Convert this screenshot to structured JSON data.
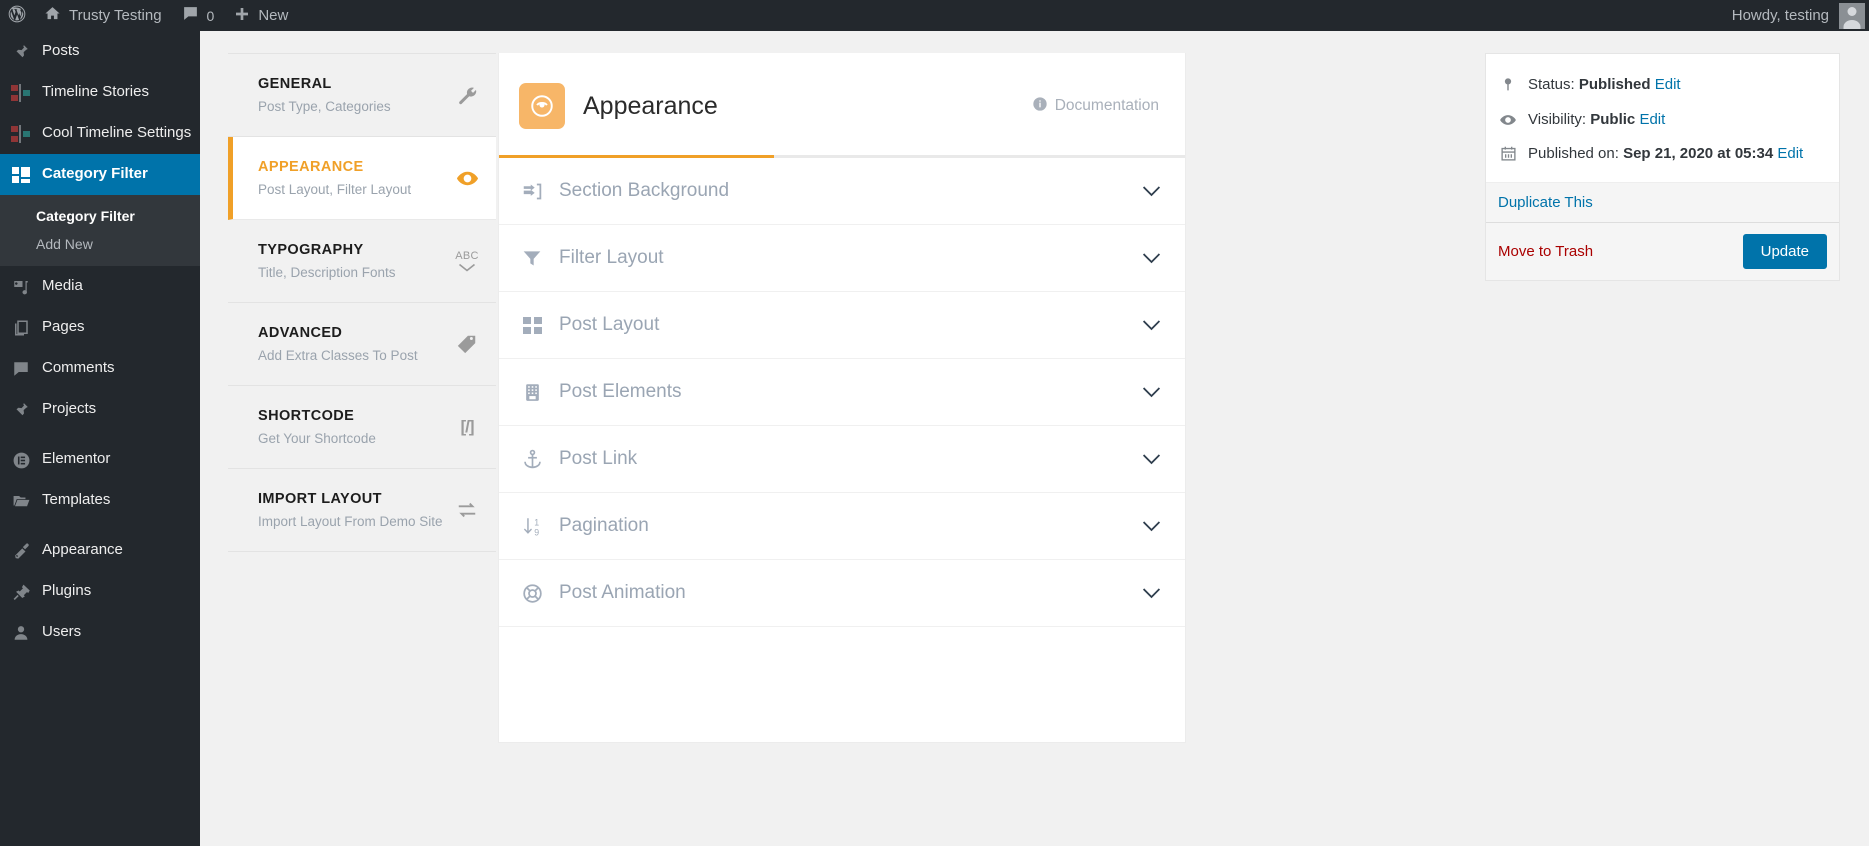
{
  "adminbar": {
    "logo_icon": "wordpress-logo-icon",
    "site_name": "Trusty Testing",
    "home_icon": "home-icon",
    "comments_icon": "comment-bubble-icon",
    "comment_count": "0",
    "new_icon": "plus-icon",
    "new_label": "New",
    "howdy": "Howdy, testing",
    "avatar_icon": "user-avatar"
  },
  "adminmenu": {
    "items": [
      {
        "label": "Posts",
        "icon": "pin-icon",
        "current": false
      },
      {
        "label": "Timeline Stories",
        "icon": "timeline-icon",
        "current": false
      },
      {
        "label": "Cool Timeline Settings",
        "icon": "timeline-icon",
        "current": false
      },
      {
        "label": "Category Filter",
        "icon": "category-filter-icon",
        "current": true
      },
      {
        "label": "Media",
        "icon": "media-icon",
        "current": false
      },
      {
        "label": "Pages",
        "icon": "pages-icon",
        "current": false
      },
      {
        "label": "Comments",
        "icon": "comment-bubble-icon",
        "current": false
      },
      {
        "label": "Projects",
        "icon": "pin-icon",
        "current": false
      },
      {
        "label": "Elementor",
        "icon": "elementor-icon",
        "current": false
      },
      {
        "label": "Templates",
        "icon": "folder-icon",
        "current": false
      },
      {
        "label": "Appearance",
        "icon": "paintbrush-icon",
        "current": false
      },
      {
        "label": "Plugins",
        "icon": "plug-icon",
        "current": false
      },
      {
        "label": "Users",
        "icon": "user-icon",
        "current": false
      }
    ],
    "submenu": [
      {
        "label": "Category Filter",
        "current": true
      },
      {
        "label": "Add New",
        "current": false
      }
    ]
  },
  "tabs": [
    {
      "title": "GENERAL",
      "sub": "Post Type, Categories",
      "icon": "wrench-icon",
      "active": false
    },
    {
      "title": "APPEARANCE",
      "sub": "Post Layout, Filter Layout",
      "icon": "eye-icon",
      "active": true
    },
    {
      "title": "TYPOGRAPHY",
      "sub": "Title, Description Fonts",
      "icon": "abc-check-icon",
      "active": false
    },
    {
      "title": "ADVANCED",
      "sub": "Add Extra Classes To Post",
      "icon": "tag-icon",
      "active": false
    },
    {
      "title": "SHORTCODE",
      "sub": "Get Your Shortcode",
      "icon": "shortcode-brackets-icon",
      "active": false
    },
    {
      "title": "IMPORT LAYOUT",
      "sub": "Import Layout From Demo Site",
      "icon": "import-exchange-icon",
      "active": false
    }
  ],
  "panel": {
    "badge_icon": "eye-icon",
    "title": "Appearance",
    "doc_icon": "info-circle-icon",
    "doc_label": "Documentation",
    "accent_color": "#f0a028",
    "sections": [
      {
        "label": "Section Background",
        "icon": "sign-in-arrow-icon"
      },
      {
        "label": "Filter Layout",
        "icon": "funnel-icon"
      },
      {
        "label": "Post Layout",
        "icon": "grid-icon"
      },
      {
        "label": "Post Elements",
        "icon": "keypad-icon"
      },
      {
        "label": "Post Link",
        "icon": "anchor-icon"
      },
      {
        "label": "Pagination",
        "icon": "sort-numeric-icon"
      },
      {
        "label": "Post Animation",
        "icon": "life-ring-icon"
      }
    ],
    "chevron_icon": "chevron-down-icon"
  },
  "publish": {
    "status_icon": "pin-marker-icon",
    "status_label": "Status:",
    "status_value": "Published",
    "status_edit": "Edit",
    "visibility_icon": "eye-icon",
    "visibility_label": "Visibility:",
    "visibility_value": "Public",
    "visibility_edit": "Edit",
    "published_icon": "calendar-icon",
    "published_label": "Published on:",
    "published_value": "Sep 21, 2020 at 05:34",
    "published_edit": "Edit",
    "duplicate_label": "Duplicate This",
    "trash_label": "Move to Trash",
    "update_label": "Update",
    "link_color": "#0073aa",
    "trash_color": "#aa0000"
  }
}
